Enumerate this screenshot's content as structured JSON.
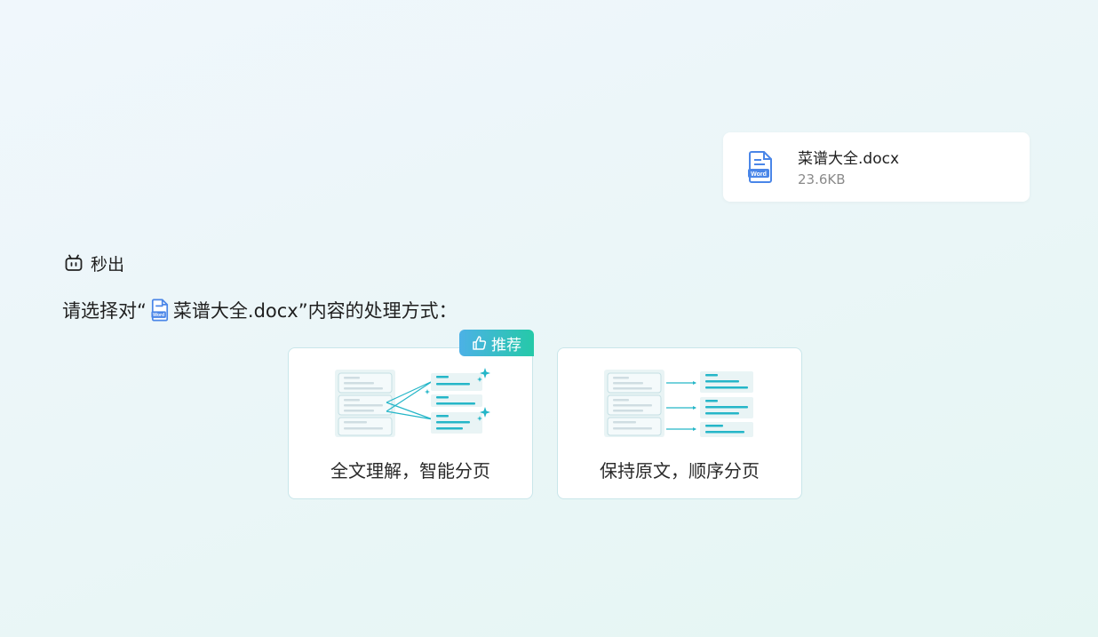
{
  "file": {
    "name": "菜谱大全.docx",
    "size": "23.6KB",
    "icon": "word-doc-icon"
  },
  "assistant": {
    "name": "秒出",
    "icon": "robot-icon"
  },
  "prompt": {
    "prefix": "请选择对“",
    "filename": "菜谱大全.docx",
    "suffix": "”内容的处理方式："
  },
  "options": [
    {
      "label": "全文理解，智能分页",
      "badge": "推荐",
      "recommended": true
    },
    {
      "label": "保持原文，顺序分页",
      "recommended": false
    }
  ],
  "colors": {
    "accent": "#25b6c8",
    "badge_start": "#4cb1e6",
    "badge_end": "#25c9a8",
    "word_blue": "#4a86e8"
  }
}
